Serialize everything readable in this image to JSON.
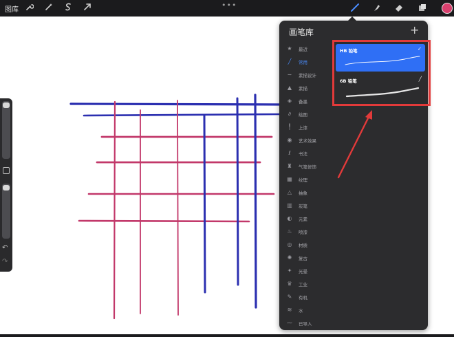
{
  "topbar": {
    "gallery": "图库",
    "tools": [
      "wrench-icon",
      "magic-wand-icon",
      "selection-icon",
      "transform-arrow-icon"
    ],
    "right_tools": [
      "brush-icon",
      "smudge-icon",
      "eraser-icon",
      "layers-icon"
    ],
    "color": "#d9406e"
  },
  "panel": {
    "title": "画笔库",
    "add": "+",
    "categories": [
      {
        "label": "最近",
        "icon": "★"
      },
      {
        "label": "常用",
        "icon": "╱",
        "active": true
      },
      {
        "label": "素描设计",
        "icon": "∼"
      },
      {
        "label": "素描",
        "icon": "▲"
      },
      {
        "label": "备墨",
        "icon": "◈"
      },
      {
        "label": "绘图",
        "icon": "∂"
      },
      {
        "label": "上漆",
        "icon": "╿"
      },
      {
        "label": "艺术效果",
        "icon": "◉"
      },
      {
        "label": "书法",
        "icon": "ℓ"
      },
      {
        "label": "气笔修饰",
        "icon": "♜"
      },
      {
        "label": "纹理",
        "icon": "▦"
      },
      {
        "label": "抽象",
        "icon": "△"
      },
      {
        "label": "炭笔",
        "icon": "▥"
      },
      {
        "label": "元素",
        "icon": "◐"
      },
      {
        "label": "喷漆",
        "icon": "♨"
      },
      {
        "label": "材质",
        "icon": "◎"
      },
      {
        "label": "复古",
        "icon": "✺"
      },
      {
        "label": "光晕",
        "icon": "✦"
      },
      {
        "label": "工业",
        "icon": "♛"
      },
      {
        "label": "有机",
        "icon": "✎"
      },
      {
        "label": "水",
        "icon": "≋"
      },
      {
        "label": "已导入",
        "icon": "⁓"
      }
    ],
    "brushes": [
      {
        "name": "HB 铅笔",
        "selected": true
      },
      {
        "name": "6B 铅笔",
        "selected": false
      }
    ]
  },
  "colors": {
    "blue": "#2b2fb0",
    "pink": "#c2386a",
    "accent": "#2f6ff5",
    "annotation": "#e23a3a"
  }
}
